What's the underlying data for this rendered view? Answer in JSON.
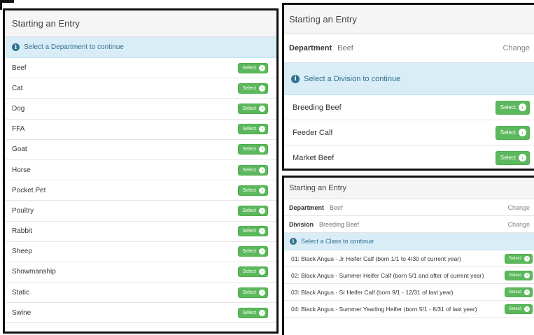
{
  "departments_panel": {
    "heading": "Starting an Entry",
    "info": "Select a Department to continue",
    "items": [
      "Beef",
      "Cat",
      "Dog",
      "FFA",
      "Goat",
      "Horse",
      "Pocket Pet",
      "Poultry",
      "Rabbit",
      "Sheep",
      "Showmanship",
      "Static",
      "Swine"
    ]
  },
  "divisions_panel": {
    "heading": "Starting an Entry",
    "department_label": "Department",
    "department_value": "Beef",
    "change_label": "Change",
    "info": "Select a Division to continue",
    "items": [
      "Breeding Beef",
      "Feeder Calf",
      "Market Beef"
    ]
  },
  "classes_panel": {
    "heading": "Starting an Entry",
    "department_label": "Department",
    "department_value": "Beef",
    "division_label": "Division",
    "division_value": "Breeding Beef",
    "change_label": "Change",
    "info": "Select a Class to continue",
    "items": [
      "01: Black Angus - Jr Heifer Calf (born 1/1 to 4/30 of current year)",
      "02: Black Angus - Summer Heifer Calf (born 5/1 and after of current year)",
      "03: Black Angus - Sr Heifer Calf (born 9/1 - 12/31 of last year)",
      "04: Black Angus - Summer Yearling Heifer (born 5/1 - 8/31 of last year)"
    ]
  },
  "select_label": "Select",
  "info_icon": "info-circle-icon",
  "arrow_icon": "chevron-circle-right-icon",
  "colors": {
    "select_button": "#5cb85c",
    "info_background": "#d9edf7",
    "info_text": "#31708f",
    "heading_background": "#f5f5f5"
  }
}
